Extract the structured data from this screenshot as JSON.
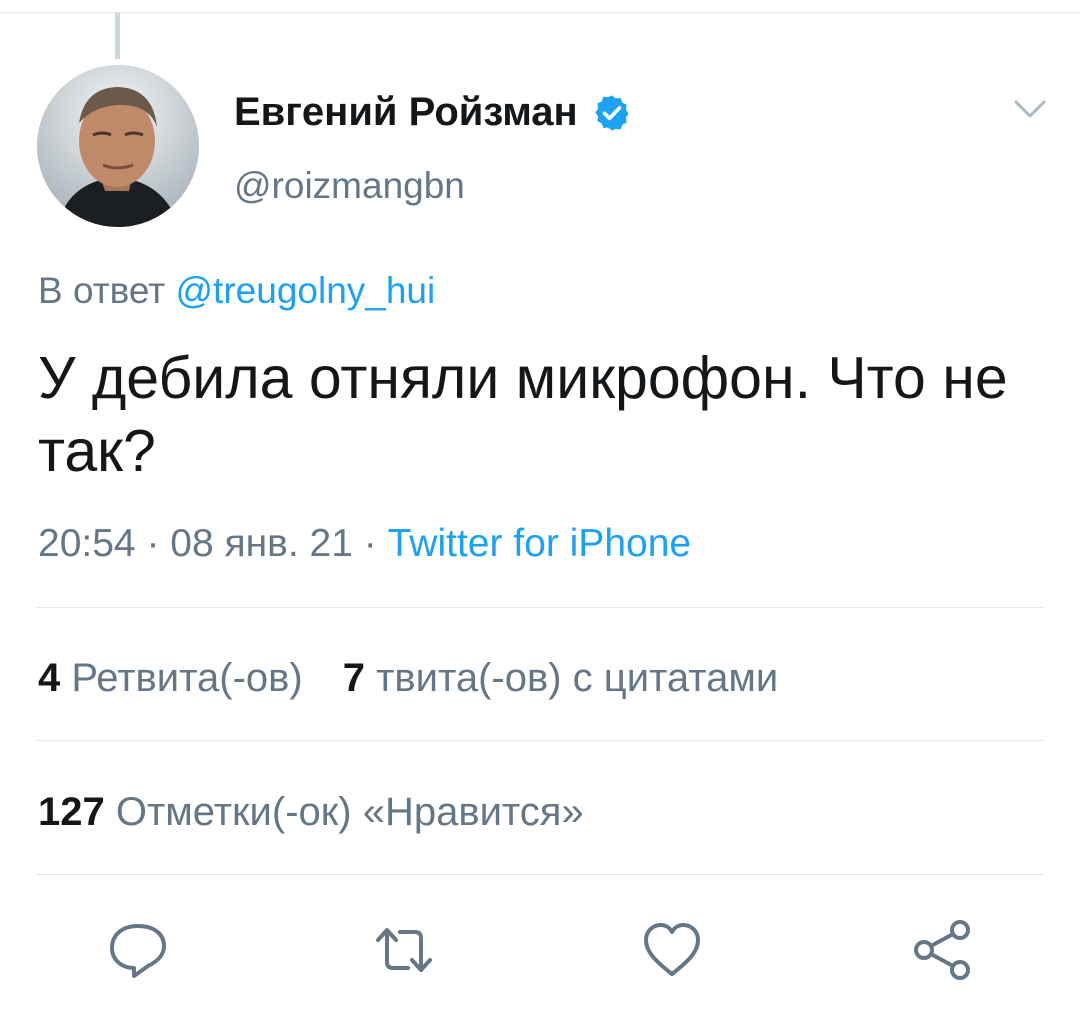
{
  "author": {
    "name": "Евгений Ройзман",
    "handle": "@roizmangbn",
    "verified": true
  },
  "reply": {
    "prefix": "В ответ",
    "mention": "@treugolny_hui"
  },
  "tweet": {
    "text": "У дебила отняли микрофон. Что не так?"
  },
  "meta": {
    "time": "20:54",
    "separator1": " · ",
    "date": "08 янв. 21",
    "separator2": " · ",
    "source": "Twitter for iPhone"
  },
  "stats": {
    "retweets_count": "4",
    "retweets_label": "Ретвита(-ов)",
    "quotes_count": "7",
    "quotes_label": "твита(-ов) с цитатами",
    "likes_count": "127",
    "likes_label": "Отметки(-ок) «Нравится»"
  },
  "icons": {
    "verified": "verified-badge-icon",
    "menu": "chevron-down-icon",
    "reply": "reply-icon",
    "retweet": "retweet-icon",
    "like": "heart-icon",
    "share": "share-icon"
  },
  "colors": {
    "accent": "#1da1f2",
    "secondary_text": "#657786",
    "primary_text": "#14171a",
    "divider": "#e1e8ed",
    "icon": "#657786"
  }
}
